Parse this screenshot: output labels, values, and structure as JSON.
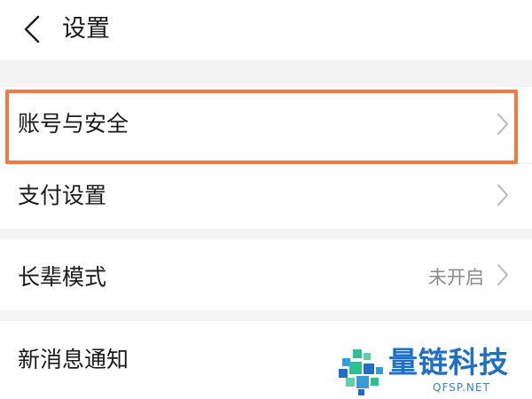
{
  "header": {
    "title": "设置",
    "back_icon": "chevron-left-icon"
  },
  "settings": {
    "account_security": {
      "label": "账号与安全",
      "icon": "chevron-right-icon"
    },
    "payment_settings": {
      "label": "支付设置",
      "icon": "chevron-right-icon"
    },
    "elder_mode": {
      "label": "长辈模式",
      "value": "未开启",
      "icon": "chevron-right-icon"
    },
    "new_message_notify": {
      "label": "新消息通知"
    }
  },
  "highlight": {
    "color": "#ef7a45"
  },
  "watermark": {
    "brand": "量链科技",
    "domain": "QFSP.NET"
  }
}
